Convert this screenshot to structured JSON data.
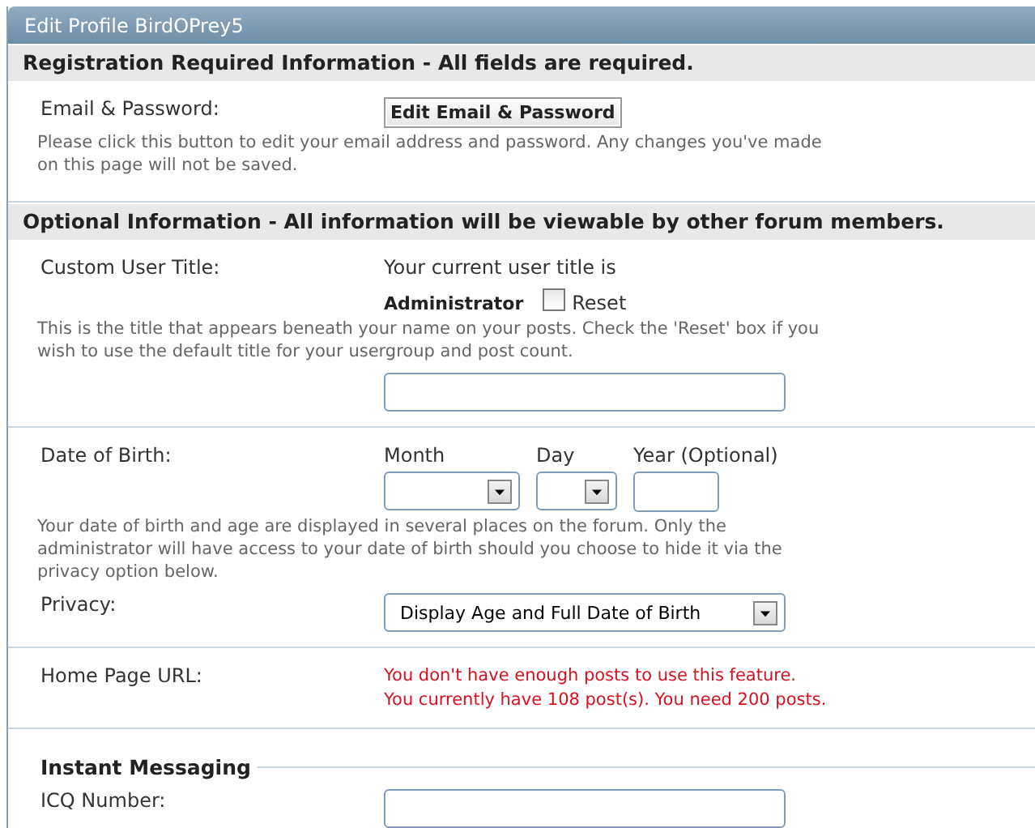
{
  "panel": {
    "title": "Edit Profile BirdOPrey5"
  },
  "sections": [
    {
      "heading": "Registration Required Information - All fields are required.",
      "blocks": [
        [
          {
            "kind": "button",
            "label": "Email & Password:",
            "button": "Edit Email & Password",
            "description": "Please click this button to edit your email address and password. Any changes you've made on this page will not be saved."
          }
        ]
      ]
    },
    {
      "heading": "Optional Information - All information will be viewable by other forum members.",
      "blocks": [
        [
          {
            "kind": "title",
            "label": "Custom User Title:",
            "intro": "Your current user title is",
            "current": "Administrator",
            "reset": {
              "label": "Reset",
              "checked": false
            },
            "description": "This is the title that appears beneath your name on your posts. Check the 'Reset' box if you wish to use the default title for your usergroup and post count."
          }
        ],
        [
          {
            "kind": "date",
            "label": "Date of Birth:",
            "fields": [
              {
                "label": "Month",
                "kind": "select"
              },
              {
                "label": "Day",
                "kind": "select"
              },
              {
                "label": "Year (Optional)",
                "kind": "text"
              }
            ],
            "description": "Your date of birth and age are displayed in several places on the forum. Only the administrator will have access to your date of birth should you choose to hide it via the privacy option below."
          },
          {
            "kind": "select",
            "label": "Privacy:",
            "value": "Display Age and Full Date of Birth"
          }
        ],
        [
          {
            "kind": "notice",
            "label": "Home Page URL:",
            "lines": [
              "You don't have enough posts to use this feature.",
              "You currently have 108 post(s). You need 200 posts."
            ]
          }
        ]
      ],
      "subsections": [
        {
          "heading": "Instant Messaging",
          "rows": [
            {
              "kind": "text",
              "label": "ICQ Number:"
            }
          ]
        }
      ]
    }
  ]
}
